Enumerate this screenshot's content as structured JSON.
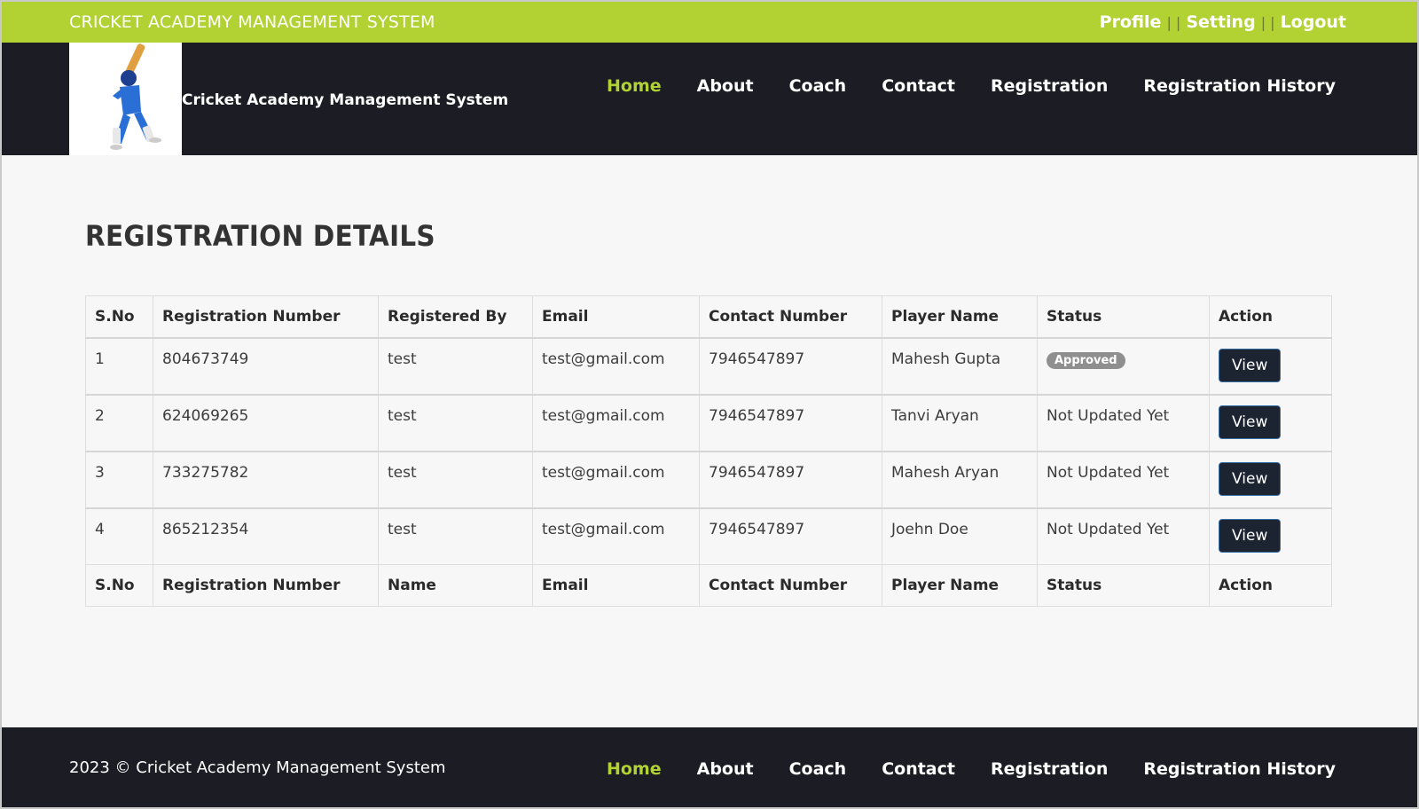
{
  "topbar": {
    "title": "CRICKET ACADEMY MANAGEMENT SYSTEM",
    "links": [
      "Profile",
      "Setting",
      "Logout"
    ],
    "separator": "| |"
  },
  "header": {
    "brand": "Cricket Academy Management System",
    "logo_icon": "cricket-batsman-logo"
  },
  "nav": {
    "items": [
      "Home",
      "About",
      "Coach",
      "Contact",
      "Registration",
      "Registration History"
    ],
    "active": "Home"
  },
  "main": {
    "page_title": "REGISTRATION DETAILS",
    "table": {
      "head": [
        "S.No",
        "Registration Number",
        "Registered By",
        "Email",
        "Contact Number",
        "Player Name",
        "Status",
        "Action"
      ],
      "foot": [
        "S.No",
        "Registration Number",
        "Name",
        "Email",
        "Contact Number",
        "Player Name",
        "Status",
        "Action"
      ],
      "rows": [
        {
          "sno": "1",
          "reg_no": "804673749",
          "registered_by": "test",
          "email": "test@gmail.com",
          "contact": "7946547897",
          "player": "Mahesh Gupta",
          "status": "Approved",
          "status_badge": true,
          "action": "View"
        },
        {
          "sno": "2",
          "reg_no": "624069265",
          "registered_by": "test",
          "email": "test@gmail.com",
          "contact": "7946547897",
          "player": "Tanvi Aryan",
          "status": "Not Updated Yet",
          "status_badge": false,
          "action": "View"
        },
        {
          "sno": "3",
          "reg_no": "733275782",
          "registered_by": "test",
          "email": "test@gmail.com",
          "contact": "7946547897",
          "player": "Mahesh Aryan",
          "status": "Not Updated Yet",
          "status_badge": false,
          "action": "View"
        },
        {
          "sno": "4",
          "reg_no": "865212354",
          "registered_by": "test",
          "email": "test@gmail.com",
          "contact": "7946547897",
          "player": "Joehn Doe",
          "status": "Not Updated Yet",
          "status_badge": false,
          "action": "View"
        }
      ]
    }
  },
  "footer": {
    "copyright": "2023 © Cricket Academy Management System"
  },
  "colors": {
    "accent": "#b2d234",
    "dark": "#1c1d24",
    "button": "#1c2331",
    "badge": "#8f8f8f"
  }
}
